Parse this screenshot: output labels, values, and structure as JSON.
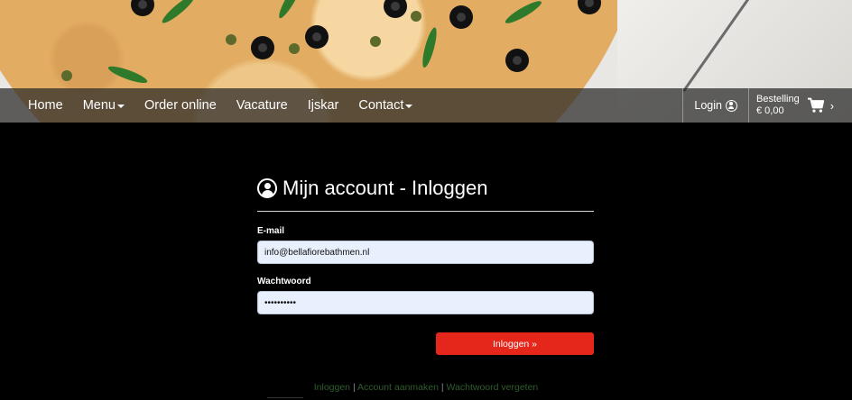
{
  "nav": {
    "items": [
      {
        "label": "Home",
        "dropdown": false
      },
      {
        "label": "Menu",
        "dropdown": true
      },
      {
        "label": "Order online",
        "dropdown": false
      },
      {
        "label": "Vacature",
        "dropdown": false
      },
      {
        "label": "Ijskar",
        "dropdown": false
      },
      {
        "label": "Contact",
        "dropdown": true
      }
    ],
    "login_label": "Login",
    "order_label": "Bestelling",
    "order_total": "€ 0,00",
    "chevron": "›"
  },
  "login": {
    "title": "Mijn account - Inloggen",
    "email_label": "E-mail",
    "email_value": "info@bellafiorebathmen.nl",
    "password_label": "Wachtwoord",
    "password_value": "••••••••••",
    "submit_label": "Inloggen »"
  },
  "footer_links": {
    "inloggen": "Inloggen",
    "account": "Account aanmaken",
    "forgot": "Wachtwoord vergeten",
    "separator": "|"
  },
  "colors": {
    "accent": "#e5261b",
    "link": "#2f5d2f",
    "input_bg": "#e8f0fe"
  },
  "icons": [
    "user-circle-icon",
    "shopping-cart-icon",
    "chevron-right-icon",
    "caret-down-icon"
  ]
}
